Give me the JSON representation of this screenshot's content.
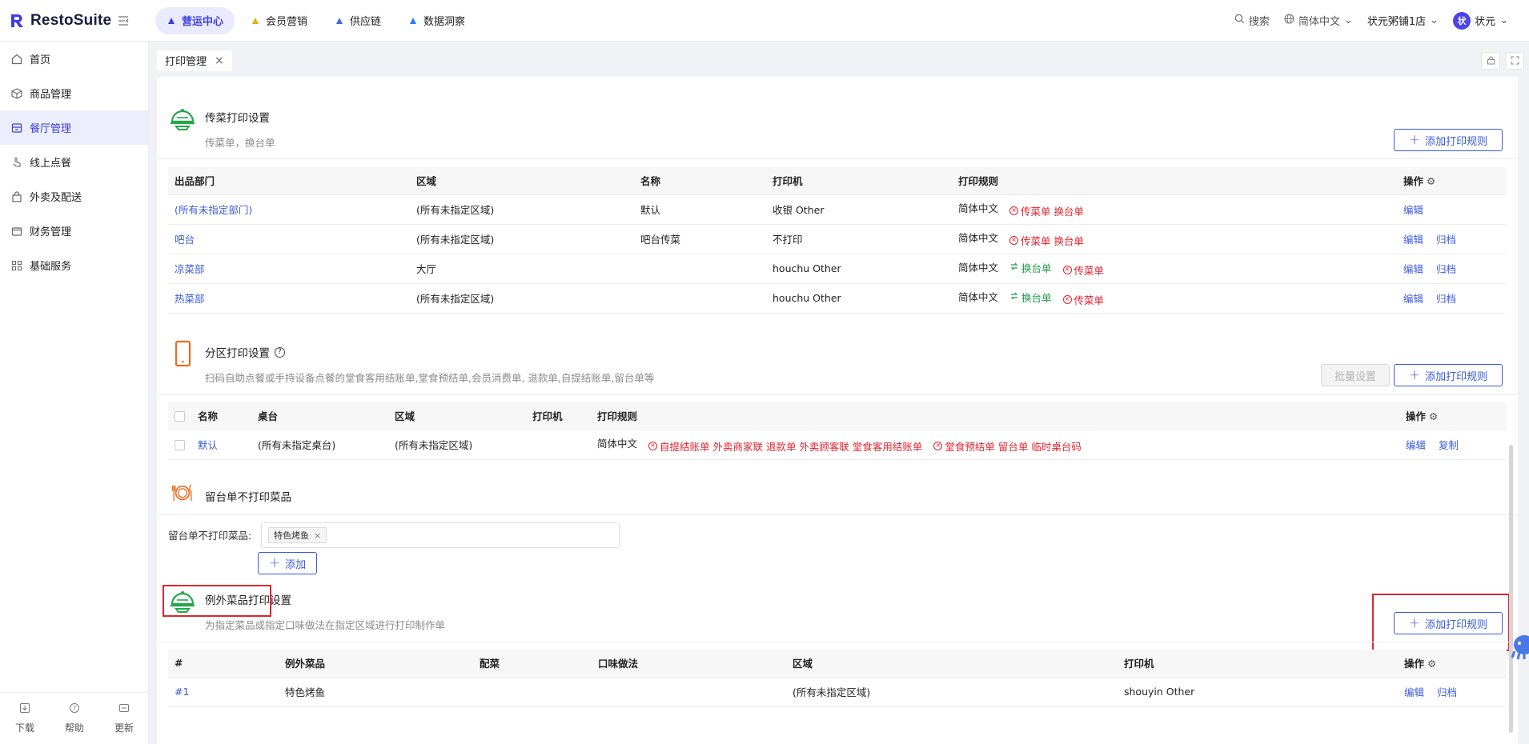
{
  "app": {
    "name": "RestoSuite"
  },
  "nav": [
    {
      "label": "营运中心",
      "active": true,
      "color": "#3c3fe0"
    },
    {
      "label": "会员营销",
      "active": false,
      "color": "#f3a417"
    },
    {
      "label": "供应链",
      "active": false,
      "color": "#3b6ae8"
    },
    {
      "label": "数据洞察",
      "active": false,
      "color": "#2e7cf6"
    }
  ],
  "topright": {
    "search": "搜索",
    "language": "简体中文",
    "store": "状元粥铺1店",
    "user": "状元",
    "avatar_initial": "状"
  },
  "sidebar": {
    "items": [
      {
        "label": "首页",
        "icon": "home-icon"
      },
      {
        "label": "商品管理",
        "icon": "box-icon"
      },
      {
        "label": "餐厅管理",
        "icon": "restaurant-icon",
        "active": true
      },
      {
        "label": "线上点餐",
        "icon": "tap-icon"
      },
      {
        "label": "外卖及配送",
        "icon": "bag-icon"
      },
      {
        "label": "财务管理",
        "icon": "wallet-icon"
      },
      {
        "label": "基础服务",
        "icon": "grid-icon"
      }
    ],
    "bottom": [
      {
        "label": "下载",
        "icon": "download-icon"
      },
      {
        "label": "帮助",
        "icon": "help-icon"
      },
      {
        "label": "更新",
        "icon": "update-icon"
      }
    ]
  },
  "tab": {
    "label": "打印管理"
  },
  "colors": {
    "primary": "#3b5bdb",
    "danger": "#e0242f",
    "success": "#1e9a4a",
    "accent": "#3c3fe0"
  },
  "section1": {
    "title": "传菜打印设置",
    "desc": "传菜单，换台单",
    "add_button": "添加打印规则",
    "columns": [
      "出品部门",
      "区域",
      "名称",
      "打印机",
      "打印规则",
      "操作"
    ],
    "rows": [
      {
        "dept": "(所有未指定部门)",
        "area": "(所有未指定区域)",
        "name": "默认",
        "printer": "收银 Other",
        "lang": "简体中文",
        "rules": [
          {
            "text": "传菜单 换台单",
            "type": "red"
          }
        ],
        "ops": [
          "编辑"
        ]
      },
      {
        "dept": "吧台",
        "area": "(所有未指定区域)",
        "name": "吧台传菜",
        "printer": "不打印",
        "lang": "简体中文",
        "rules": [
          {
            "text": "传菜单 换台单",
            "type": "red"
          }
        ],
        "ops": [
          "编辑",
          "归档"
        ]
      },
      {
        "dept": "凉菜部",
        "area": "大厅",
        "name": "",
        "printer": "houchu Other",
        "lang": "简体中文",
        "rules": [
          {
            "text": "换台单",
            "type": "green"
          },
          {
            "text": "传菜单",
            "type": "red"
          }
        ],
        "ops": [
          "编辑",
          "归档"
        ]
      },
      {
        "dept": "热菜部",
        "area": "(所有未指定区域)",
        "name": "",
        "printer": "houchu Other",
        "lang": "简体中文",
        "rules": [
          {
            "text": "换台单",
            "type": "green"
          },
          {
            "text": "传菜单",
            "type": "red"
          }
        ],
        "ops": [
          "编辑",
          "归档"
        ]
      }
    ]
  },
  "section2": {
    "title": "分区打印设置",
    "desc": "扫码自助点餐或手持设备点餐的堂食客用结账单,堂食预结单,会员消费单, 退款单,自提结账单,留台单等",
    "batch_button": "批量设置",
    "add_button": "添加打印规则",
    "columns": [
      "名称",
      "桌台",
      "区域",
      "打印机",
      "打印规则",
      "操作"
    ],
    "rows": [
      {
        "name": "默认",
        "table": "(所有未指定桌台)",
        "area": "(所有未指定区域)",
        "printer": "",
        "lang": "简体中文",
        "rules": [
          {
            "text": "自提结账单 外卖商家联 退款单 外卖顾客联 堂食客用结账单",
            "type": "red"
          },
          {
            "text": "堂食预结单 留台单 临时桌台码",
            "type": "red"
          }
        ],
        "ops": [
          "编辑",
          "复制"
        ]
      }
    ]
  },
  "section3": {
    "title": "留台单不打印菜品",
    "field_label": "留台单不打印菜品:",
    "chips": [
      "特色烤鱼"
    ],
    "add_button": "添加"
  },
  "section4": {
    "title": "例外菜品打印设置",
    "desc": "为指定菜品或指定口味做法在指定区域进行打印制作单",
    "add_button": "添加打印规则",
    "columns": [
      "#",
      "例外菜品",
      "配菜",
      "口味做法",
      "区域",
      "打印机",
      "操作"
    ],
    "rows": [
      {
        "no": "#1",
        "dish": "特色烤鱼",
        "side": "",
        "flavor": "",
        "area": "(所有未指定区域)",
        "printer": "shouyin Other",
        "ops": [
          "编辑",
          "归档"
        ]
      }
    ]
  }
}
